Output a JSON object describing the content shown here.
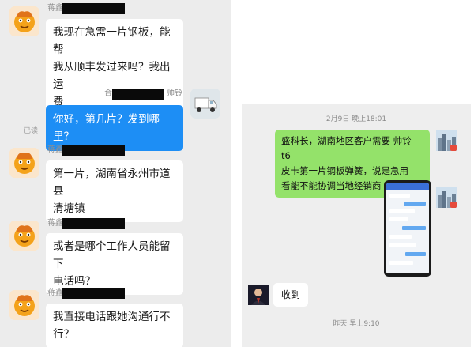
{
  "left_chat": {
    "messages": [
      {
        "sender": "蒋鑫",
        "text": "我现在急需一片钢板，能帮我从顺丰发过来吗？我出运费",
        "lines": [
          "我现在急需一片钢板，能帮",
          "我从顺丰发过来吗？我出运",
          "费"
        ]
      },
      {
        "sender": "帅铃",
        "sender_prefix": "合",
        "text": "你好，第几片？发到哪里？",
        "status": "已读"
      },
      {
        "sender": "蒋鑫",
        "text": "第一片，湖南省永州市道县清塘镇",
        "lines": [
          "第一片，湖南省永州市道县",
          "清塘镇"
        ]
      },
      {
        "sender": "蒋鑫",
        "text": "或者是哪个工作人员能留下电话吗？",
        "lines": [
          "或者是哪个工作人员能留下",
          "电话吗？"
        ]
      },
      {
        "sender": "蒋鑫",
        "text": "我直接电话跟她沟通行不行？",
        "lines": [
          "我直接电话跟她沟通行不",
          "行？"
        ]
      }
    ]
  },
  "right_chat": {
    "timestamp_top": "2月9日 晚上18:01",
    "message_green": "盛科长，湖南地区客户需要 帅铃 t6皮卡第一片钢板弹簧，说是急用看能不能协调当地经销商 帮发一下",
    "green_lines": [
      "盛科长，湖南地区客户需要 帅铃 t6",
      "皮卡第一片钢板弹簧，说是急用",
      "看能不能协调当地经销商 帮发一下"
    ],
    "reply": "收到",
    "timestamp_bottom": "昨天 早上9:10"
  },
  "colors": {
    "left_bg": "#ececec",
    "blue_bubble": "#1d8ef5",
    "green_bubble": "#94e26a",
    "redaction": "#0a0a0a"
  },
  "icons": [
    "cartoon-face-avatar",
    "truck-avatar",
    "city-skyline-avatar",
    "person-avatar",
    "phone-screenshot"
  ]
}
